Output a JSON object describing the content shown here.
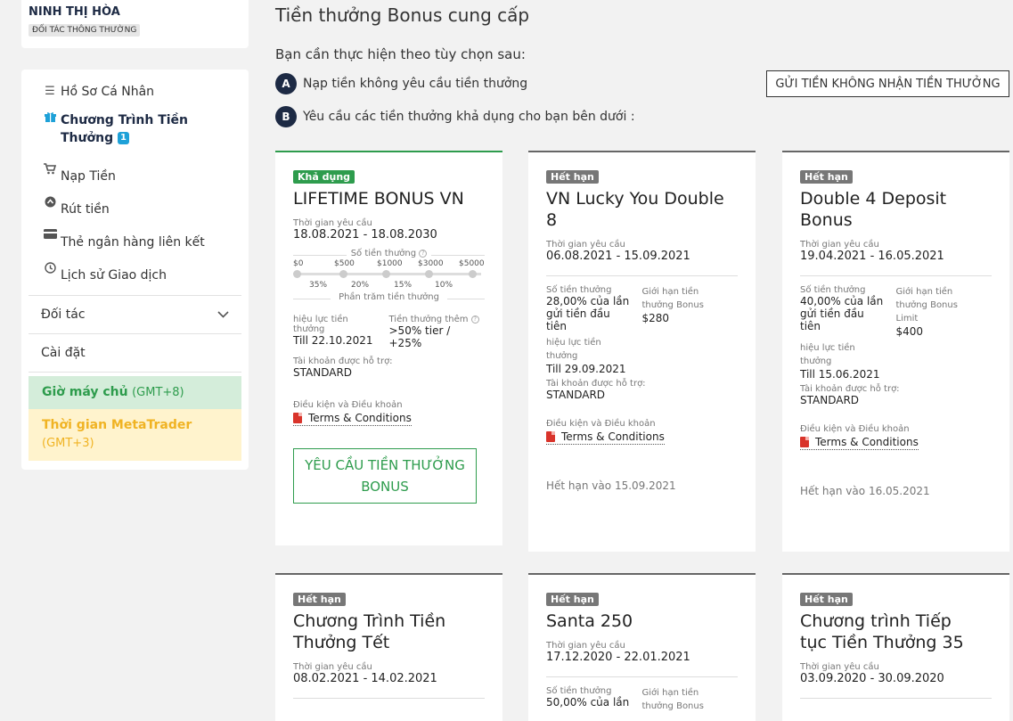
{
  "profile": {
    "name": "NINH THỊ HÒA",
    "role": "ĐỐI TÁC THÔNG THƯỜNG"
  },
  "menu": {
    "profile": "Hồ Sơ Cá Nhân",
    "bonus_line1": "Chương Trình Tiền",
    "bonus_line2": "Thưởng",
    "bonus_count": "1",
    "deposit": "Nạp Tiền",
    "withdraw": "Rút tiền",
    "bank_cards": "Thẻ ngân hàng liên kết",
    "history": "Lịch sử Giao dịch",
    "partner": "Đối tác",
    "settings": "Cài đặt"
  },
  "clocks": {
    "server_label": "Giờ máy chủ",
    "server_tz": "(GMT+8)",
    "mt_label": "Thời gian MetaTrader",
    "mt_tz": "(GMT+3)"
  },
  "main": {
    "title": "Tiền thưởng Bonus cung cấp",
    "subtitle": "Bạn cần thực hiện theo tùy chọn sau:",
    "option_a_letter": "A",
    "option_a": "Nạp tiền không yêu cầu tiền thưởng",
    "option_b_letter": "B",
    "option_b": "Yêu cầu các tiền thưởng khả dụng cho bạn bên dưới :",
    "no_bonus_button": "GỬI TIỀN KHÔNG NHẬN TIỀN THƯỞNG"
  },
  "labels": {
    "request_time": "Thời gian yêu cầu",
    "bonus_amount": "Số tiền thưởng",
    "bonus_percent": "Phần trăm tiền thưởng",
    "validity_1": "hiệu lực tiền",
    "validity_2": "thưởng",
    "extra_bonus": "Tiền thưởng thêm",
    "supported_accounts": "Tài khoản được hỗ trợ:",
    "terms_label": "Điều kiện và Điều khoản",
    "terms_link": "Terms & Conditions",
    "limit_1": "Giới hạn tiền",
    "limit_2": "thưởng Bonus",
    "limit_3": "Limit",
    "status_available": "Khả dụng",
    "status_expired": "Hết hạn",
    "expired_on": "Hết hạn vào"
  },
  "slider": {
    "amounts": [
      "$0",
      "$500",
      "$1000",
      "$3000",
      "$5000"
    ],
    "percents": [
      "35%",
      "20%",
      "15%",
      "10%"
    ]
  },
  "cards": [
    {
      "title": "LIFETIME BONUS VN",
      "period": "18.08.2021 - 18.08.2030",
      "validity": "Till 22.10.2021",
      "extra": ">50% tier / +25%",
      "account": "STANDARD",
      "request_button_1": "YÊU CẦU TIỀN THƯỞNG",
      "request_button_2": "BONUS"
    },
    {
      "title_1": "VN Lucky You Double",
      "title_2": "8",
      "period": "06.08.2021 - 15.09.2021",
      "bonus_1": "28,00% của lần",
      "bonus_2": "gửi tiền đầu",
      "bonus_3": "tiên",
      "limit": "$280",
      "validity": "Till 29.09.2021",
      "account": "STANDARD",
      "expiry_date": "15.09.2021"
    },
    {
      "title_1": "Double 4 Deposit",
      "title_2": "Bonus",
      "period": "19.04.2021 - 16.05.2021",
      "bonus_1": "40,00% của lần",
      "bonus_2": "gửi tiền đầu",
      "bonus_3": "tiên",
      "limit": "$400",
      "validity": "Till 15.06.2021",
      "account": "STANDARD",
      "expiry_date": "16.05.2021"
    },
    {
      "title_1": "Chương Trình Tiền",
      "title_2": "Thưởng Tết",
      "period": "08.02.2021 - 14.02.2021"
    },
    {
      "title_1": "Santa 250",
      "period": "17.12.2020 - 22.01.2021",
      "bonus_1": "50,00% của lần",
      "limit_1": "Giới hạn tiền",
      "limit_2": "thưởng Bonus"
    },
    {
      "title_1": "Chương trình Tiếp",
      "title_2": "tục Tiền Thưởng 35",
      "period": "03.09.2020 - 30.09.2020"
    }
  ],
  "colors": {
    "green": "#2e9c4d",
    "navy": "#1d2a44",
    "accent": "#1ea1d8",
    "gold": "#f0b323"
  },
  "icons": [
    "menu-icon",
    "gift-icon",
    "cart-icon",
    "withdraw-icon",
    "card-icon",
    "clock-icon",
    "chevron-down-icon",
    "pdf-icon",
    "question-icon"
  ]
}
